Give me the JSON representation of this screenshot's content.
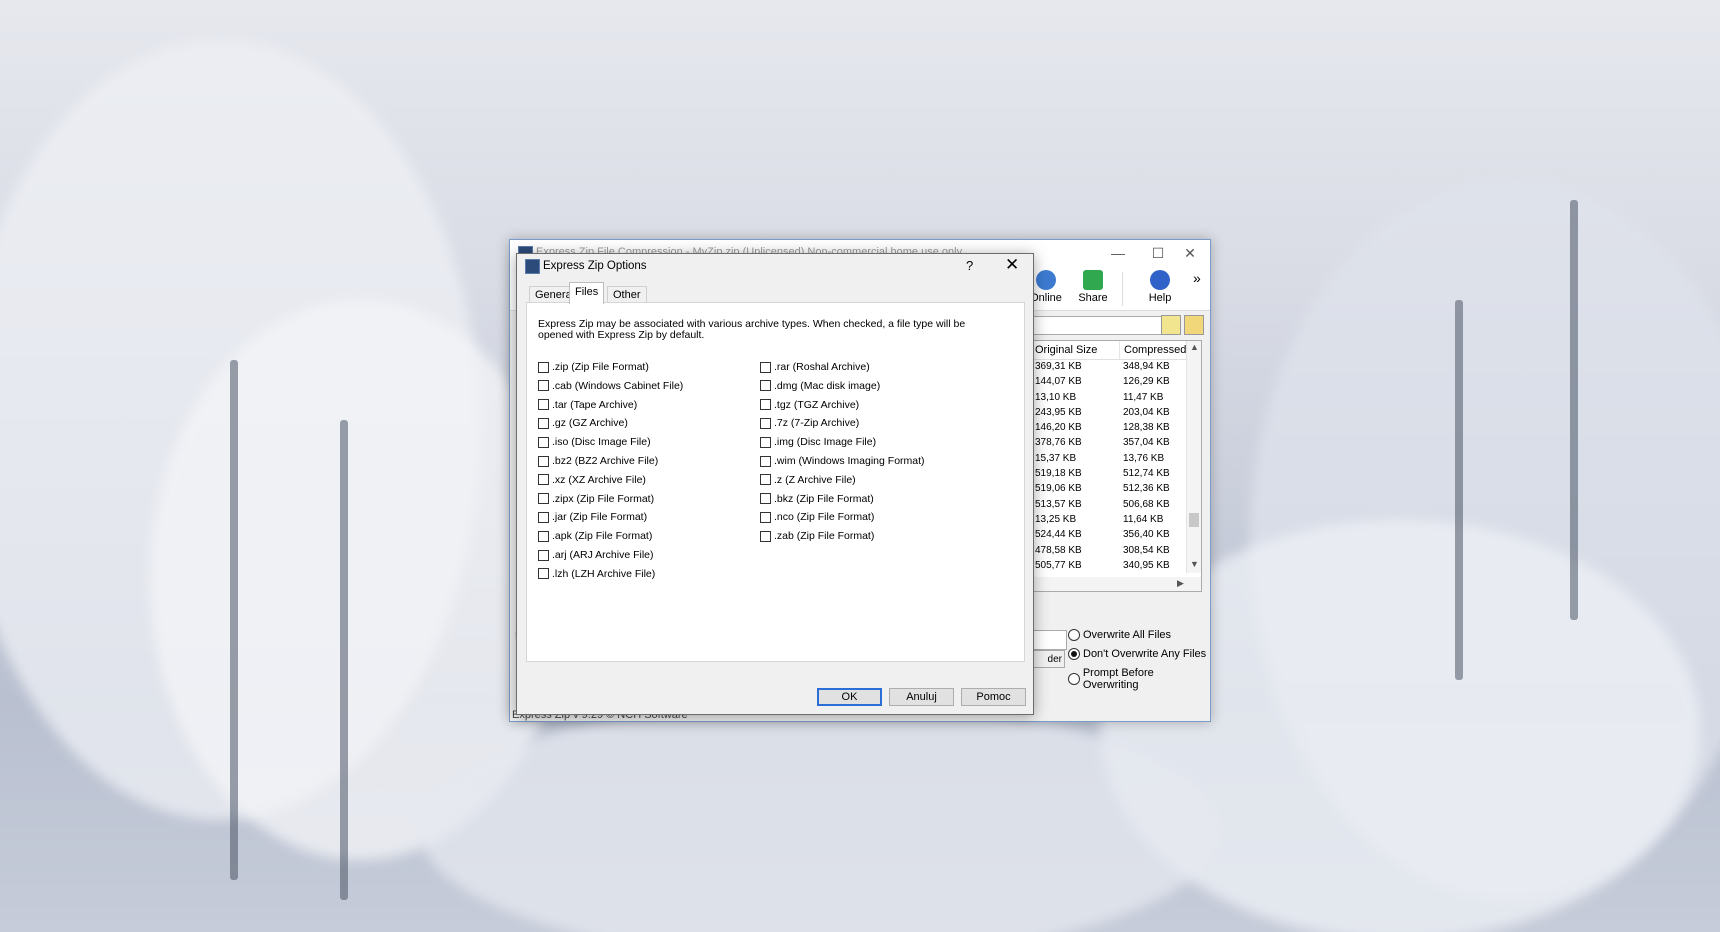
{
  "main_window": {
    "title": "Express Zip File Compression - MyZip.zip (Unlicensed) Non-commercial home use only",
    "controls": {
      "minimize": "—",
      "maximize": "☐",
      "close": "✕"
    },
    "toolbar": {
      "items": [
        {
          "label": "Online",
          "icon": "globe-icon"
        },
        {
          "label": "Share",
          "icon": "share-icon"
        },
        {
          "label": "Help",
          "icon": "help-icon"
        }
      ],
      "overflow": "»"
    },
    "file_list": {
      "columns": [
        "Original Size",
        "Compressed"
      ],
      "rows": [
        [
          "369,31 KB",
          "348,94 KB"
        ],
        [
          "144,07 KB",
          "126,29 KB"
        ],
        [
          "13,10 KB",
          "11,47 KB"
        ],
        [
          "243,95 KB",
          "203,04 KB"
        ],
        [
          "146,20 KB",
          "128,38 KB"
        ],
        [
          "378,76 KB",
          "357,04 KB"
        ],
        [
          "15,37 KB",
          "13,76 KB"
        ],
        [
          "519,18 KB",
          "512,74 KB"
        ],
        [
          "519,06 KB",
          "512,36 KB"
        ],
        [
          "513,57 KB",
          "506,68 KB"
        ],
        [
          "13,25 KB",
          "11,64 KB"
        ],
        [
          "524,44 KB",
          "356,40 KB"
        ],
        [
          "478,58 KB",
          "308,54 KB"
        ],
        [
          "505,77 KB",
          "340,95 KB"
        ]
      ]
    },
    "overwrite_options": {
      "selected": 1,
      "items": [
        "Overwrite All Files",
        "Don't Overwrite Any Files",
        "Prompt Before Overwriting"
      ]
    },
    "folder_button_stub": "der",
    "left_stub": "E",
    "status_text": "Express Zip v 9.29 © NCH Software"
  },
  "dialog": {
    "title": "Express Zip Options",
    "help_glyph": "?",
    "close_glyph": "✕",
    "tabs": [
      {
        "label": "General",
        "active": false
      },
      {
        "label": "Files",
        "active": true
      },
      {
        "label": "Other",
        "active": false
      }
    ],
    "description": "Express Zip may be associated with various archive types.  When checked, a file type will be opened with Express Zip by default.",
    "left_types": [
      ".zip (Zip File Format)",
      ".cab (Windows Cabinet File)",
      ".tar (Tape Archive)",
      ".gz (GZ Archive)",
      ".iso (Disc Image File)",
      ".bz2 (BZ2 Archive File)",
      ".xz (XZ Archive File)",
      ".zipx (Zip File Format)",
      ".jar (Zip File Format)",
      ".apk (Zip File Format)",
      ".arj (ARJ Archive File)",
      ".lzh (LZH Archive File)"
    ],
    "right_types": [
      ".rar (Roshal Archive)",
      ".dmg (Mac disk image)",
      ".tgz (TGZ Archive)",
      ".7z (7-Zip Archive)",
      ".img (Disc Image File)",
      ".wim (Windows Imaging Format)",
      ".z (Z Archive File)",
      ".bkz (Zip File Format)",
      ".nco (Zip File Format)",
      ".zab (Zip File Format)"
    ],
    "buttons": {
      "ok": "OK",
      "cancel": "Anuluj",
      "help": "Pomoc"
    }
  }
}
